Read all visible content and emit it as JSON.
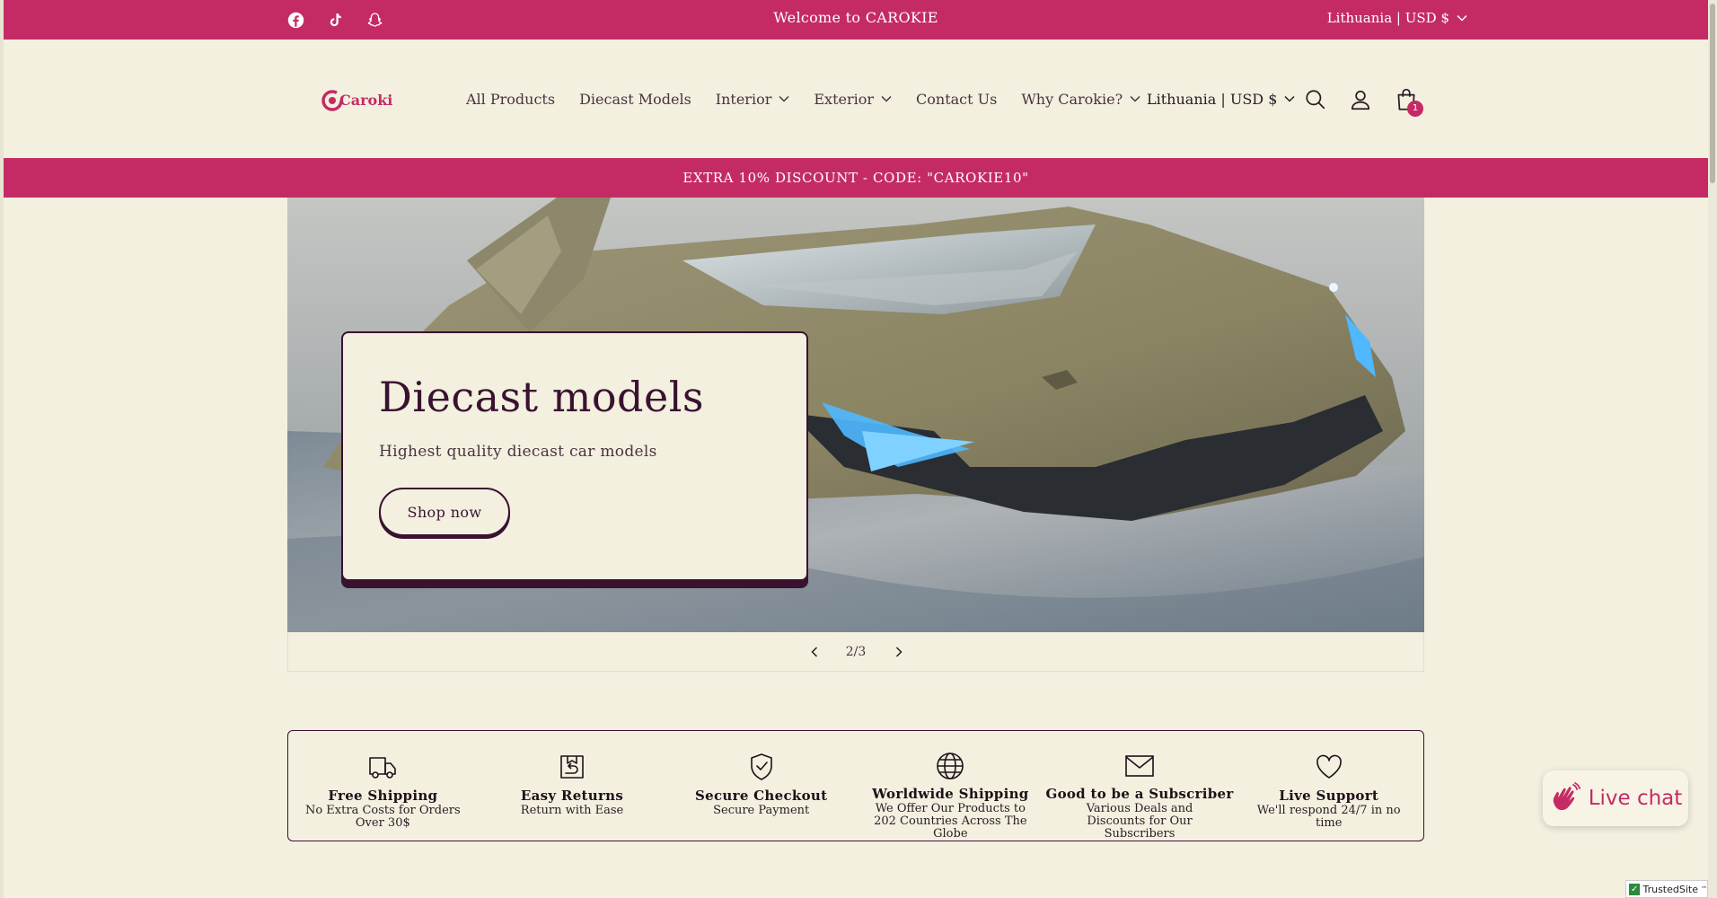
{
  "topbar": {
    "welcome": "Welcome to CAROKIE",
    "locale": "Lithuania | USD $",
    "socials": [
      "facebook-icon",
      "tiktok-icon",
      "snapchat-icon"
    ]
  },
  "header": {
    "logo_text": "Carokie",
    "nav": [
      {
        "label": "All Products",
        "dropdown": false
      },
      {
        "label": "Diecast Models",
        "dropdown": false
      },
      {
        "label": "Interior",
        "dropdown": true
      },
      {
        "label": "Exterior",
        "dropdown": true
      },
      {
        "label": "Contact Us",
        "dropdown": false
      },
      {
        "label": "Why Carokie?",
        "dropdown": true
      }
    ],
    "locale": "Lithuania | USD $",
    "cart_count": "1"
  },
  "promo": {
    "text": "EXTRA 10% DISCOUNT - CODE: \"CAROKIE10\""
  },
  "hero": {
    "title": "Diecast models",
    "subtitle": "Highest quality diecast car models",
    "button": "Shop now"
  },
  "slider": {
    "counter": "2/3"
  },
  "features": [
    {
      "icon": "truck-icon",
      "title": "Free Shipping",
      "desc": "No Extra Costs for Orders Over 30$"
    },
    {
      "icon": "return-box-icon",
      "title": "Easy Returns",
      "desc": "Return with Ease"
    },
    {
      "icon": "shield-check-icon",
      "title": "Secure Checkout",
      "desc": "Secure Payment"
    },
    {
      "icon": "globe-icon",
      "title": "Worldwide Shipping",
      "desc": "We Offer Our Products to 202 Countries Across The Globe"
    },
    {
      "icon": "envelope-icon",
      "title": "Good to be a Subscriber",
      "desc": "Various Deals and Discounts for Our Subscribers"
    },
    {
      "icon": "heart-icon",
      "title": "Live Support",
      "desc": "We'll respond 24/7 in no time"
    }
  ],
  "livechat": {
    "label": "Live chat"
  },
  "trusted": {
    "label": "TrustedSite",
    "mark": "™"
  },
  "colors": {
    "brand": "#c42b65",
    "background": "#f3f0e0",
    "dark": "#3a1230"
  }
}
